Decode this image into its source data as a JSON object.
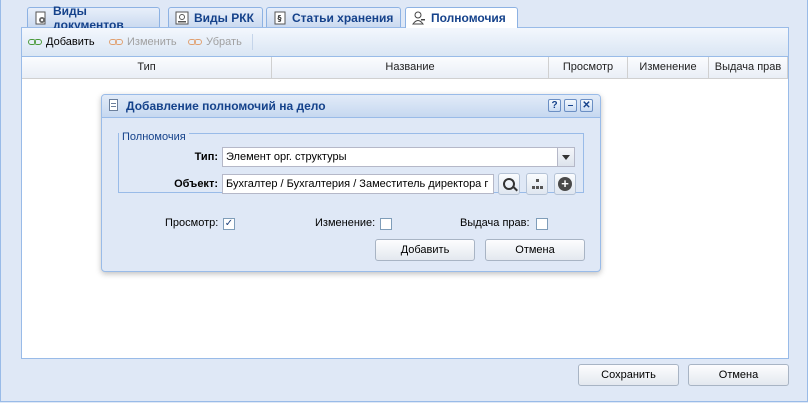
{
  "tabs": [
    {
      "label": "Виды документов",
      "icon": "document-gear-icon",
      "active": false
    },
    {
      "label": "Виды РКК",
      "icon": "card-icon",
      "active": false
    },
    {
      "label": "Статьи хранения",
      "icon": "storage-article-icon",
      "active": false
    },
    {
      "label": "Полномочия",
      "icon": "user-key-icon",
      "active": true
    }
  ],
  "toolbar": {
    "add_label": "Добавить",
    "edit_label": "Изменить",
    "remove_label": "Убрать"
  },
  "grid": {
    "columns": [
      "Тип",
      "Название",
      "Просмотр",
      "Изменение",
      "Выдача прав"
    ]
  },
  "dialog": {
    "title": "Добавление полномочий на дело",
    "fieldset_legend": "Полномочия",
    "type_label": "Тип:",
    "type_value": "Элемент орг. структуры",
    "object_label": "Объект:",
    "object_value": "Бухгалтер / Бухгалтерия / Заместитель директора г",
    "view_label": "Просмотр:",
    "view_checked": true,
    "edit_label": "Изменение:",
    "edit_checked": false,
    "grant_label": "Выдача прав:",
    "grant_checked": false,
    "add_button": "Добавить",
    "cancel_button": "Отмена",
    "help_glyph": "?",
    "minimize_glyph": "–",
    "close_glyph": "✕",
    "check_glyph": "✓",
    "plus_glyph": "+"
  },
  "footer": {
    "save_button": "Сохранить",
    "cancel_button": "Отмена"
  },
  "colors": {
    "header_text": "#15428b",
    "border": "#99bbe8",
    "background": "#dfe8f6"
  }
}
